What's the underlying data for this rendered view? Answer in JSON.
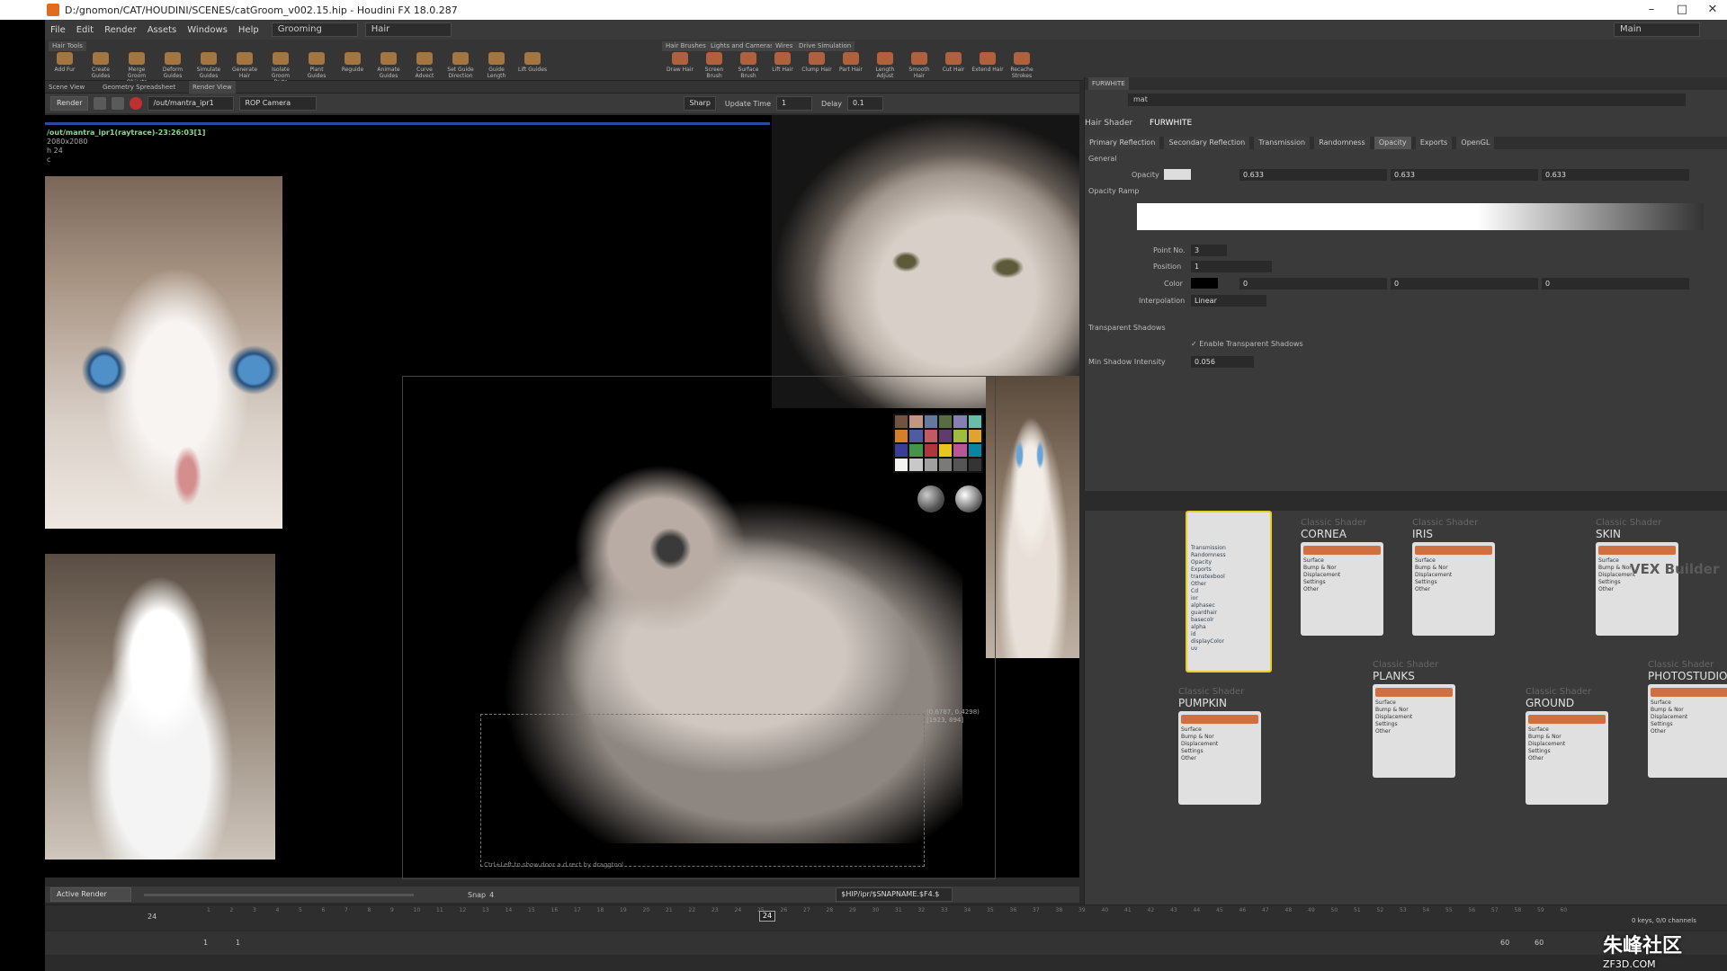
{
  "window": {
    "title": "D:/gnomon/CAT/HOUDINI/SCENES/catGroom_v002.15.hip - Houdini FX 18.0.287"
  },
  "menu": {
    "items": [
      "File",
      "Edit",
      "Render",
      "Assets",
      "Windows",
      "Help"
    ],
    "desktop": "Grooming",
    "context": "Hair",
    "workspace": "Main"
  },
  "shelf": {
    "left_tab": "Hair Tools",
    "left_tools": [
      "Add Fur",
      "Create Guides",
      "Merge Groom Objects",
      "Deform Guides",
      "Simulate Guides",
      "Generate Hair",
      "Isolate Groom Parts",
      "Plant Guides",
      "Reguide",
      "Animate Guides",
      "Curve Advect",
      "Set Guide Direction",
      "Guide Length",
      "Lift Guides"
    ],
    "right_tabs": [
      "Hair Brushes",
      "Lights and Cameras",
      "Wires",
      "Drive Simulation"
    ],
    "right_tools": [
      "Draw Hair",
      "Screen Brush",
      "Surface Brush",
      "Lift Hair",
      "Clump Hair",
      "Part Hair",
      "Length Adjust",
      "Smooth Hair",
      "Cut Hair",
      "Extend Hair",
      "Recache Strokes"
    ]
  },
  "panes": {
    "tabs": [
      "Scene View",
      "Geometry Spreadsheet",
      "Render View"
    ],
    "right_tab": "FURWHITE"
  },
  "render_bar": {
    "render_btn": "Render",
    "rop": "/out/mantra_ipr1",
    "camera": "ROP Camera",
    "sharp": "Sharp",
    "update_label": "Update Time",
    "update_value": "1",
    "delay_label": "Delay",
    "delay_value": "0.1"
  },
  "viewer": {
    "info_line1": "/out/mantra_ipr1(raytrace)-23:26:03[1]",
    "info_line2": "2080x2080",
    "info_line3": "h 24",
    "info_line4": "c",
    "coord_line1": "(0.6787, 0.4298)",
    "coord_line2": "[1923, 894]",
    "hint": "Ctrl+Left to show door a d rect by draggtool"
  },
  "viewer_bottom": {
    "mode": "Active Render",
    "snap": "Snap",
    "snap_value": "4",
    "path": "$HIP/ipr/$SNAPNAME.$F4.$"
  },
  "timeline": {
    "frame": "24",
    "ticks": [
      "1",
      "2",
      "3",
      "4",
      "5",
      "6",
      "7",
      "8",
      "9",
      "10",
      "11",
      "12",
      "13",
      "14",
      "15",
      "16",
      "17",
      "18",
      "19",
      "20",
      "21",
      "22",
      "23",
      "24",
      "25",
      "26",
      "27",
      "28",
      "29",
      "30",
      "31",
      "32",
      "33",
      "34",
      "35",
      "36",
      "37",
      "38",
      "39",
      "40",
      "41",
      "42",
      "43",
      "44",
      "45",
      "46",
      "47",
      "48",
      "49",
      "50",
      "51",
      "52",
      "53",
      "54",
      "55",
      "56",
      "57",
      "58",
      "59",
      "60"
    ],
    "start": "1",
    "start2": "1",
    "end": "60",
    "end2": "60",
    "keys": "0 keys, 0/0 channels"
  },
  "params": {
    "path": "mat",
    "shader_label": "Hair Shader",
    "shader_name": "FURWHITE",
    "tabs": [
      "Primary Reflection",
      "Secondary Reflection",
      "Transmission",
      "Randomness",
      "Opacity",
      "Exports",
      "OpenGL"
    ],
    "section_general": "General",
    "opacity_label": "Opacity",
    "opacity_values": [
      "0.633",
      "0.633",
      "0.633"
    ],
    "ramp_label": "Opacity Ramp",
    "point_label": "Point No.",
    "point_value": "3",
    "position_label": "Position",
    "position_value": "1",
    "color_label": "Color",
    "color_values": [
      "0",
      "0",
      "0"
    ],
    "interp_label": "Interpolation",
    "interp_value": "Linear",
    "section_shadows": "Transparent Shadows",
    "enable_shadows": "Enable Transparent Shadows",
    "min_shadow_label": "Min Shadow Intensity",
    "min_shadow_value": "0.056"
  },
  "network": {
    "title": "VEX Builder",
    "nodes": [
      {
        "type": "Classic Shader",
        "name": "CORNEA"
      },
      {
        "type": "Classic Shader",
        "name": "IRIS"
      },
      {
        "type": "Classic Shader",
        "name": "SKIN"
      },
      {
        "type": "Classic Shader",
        "name": "PUMPKIN"
      },
      {
        "type": "Classic Shader",
        "name": "PLANKS"
      },
      {
        "type": "Classic Shader",
        "name": "GROUND"
      },
      {
        "type": "Classic Shader",
        "name": "PHOTOSTUDIO"
      }
    ],
    "port_rows": [
      "Surface",
      "Bump & Nor",
      "Displacement",
      "Settings",
      "Other"
    ],
    "large_node_rows": [
      "Transmission",
      "Randomness",
      "Opacity",
      "Exports",
      "transtexbool",
      "Other",
      "Cd",
      "ior",
      "alphasec",
      "guardhair",
      "basecolr",
      "alpha",
      "id",
      "displayColor",
      "uv"
    ]
  },
  "watermark": {
    "main": "朱峰社区",
    "sub": "ZF3D.COM"
  }
}
